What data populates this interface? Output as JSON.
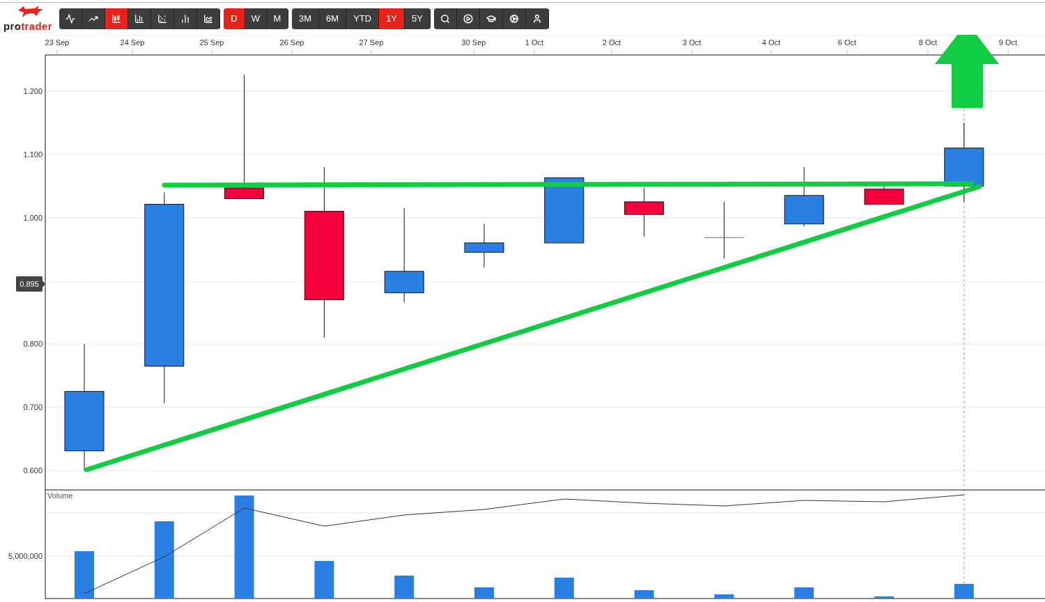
{
  "logo": {
    "text_start": "pro",
    "text_end": "trader"
  },
  "chart_types": [
    {
      "kind": "ohlc",
      "selected": false
    },
    {
      "kind": "line",
      "selected": false
    },
    {
      "kind": "candles",
      "selected": true
    },
    {
      "kind": "columns",
      "selected": false
    },
    {
      "kind": "dots",
      "selected": false
    },
    {
      "kind": "bars",
      "selected": false
    },
    {
      "kind": "area",
      "selected": false
    }
  ],
  "intervals": [
    {
      "label": "D",
      "selected": true
    },
    {
      "label": "W",
      "selected": false
    },
    {
      "label": "M",
      "selected": false
    }
  ],
  "ranges": [
    {
      "label": "3M",
      "selected": false
    },
    {
      "label": "6M",
      "selected": false
    },
    {
      "label": "YTD",
      "selected": false
    },
    {
      "label": "1Y",
      "selected": true
    },
    {
      "label": "5Y",
      "selected": false
    }
  ],
  "price_chart": {
    "price_tag": "0.895",
    "date_labels": [
      "23 Sep",
      "24 Sep",
      "25 Sep",
      "26 Sep",
      "27 Sep",
      "30 Sep",
      "1 Oct",
      "2 Oct",
      "3 Oct",
      "4 Oct",
      "6 Oct",
      "8 Oct",
      "9 Oct"
    ],
    "price_labels": [
      "1.200",
      "1.100",
      "1.000",
      "0.800",
      "0.700",
      "0.600"
    ]
  },
  "volume_chart": {
    "title": "Volume",
    "tick": "5,000,000"
  }
}
